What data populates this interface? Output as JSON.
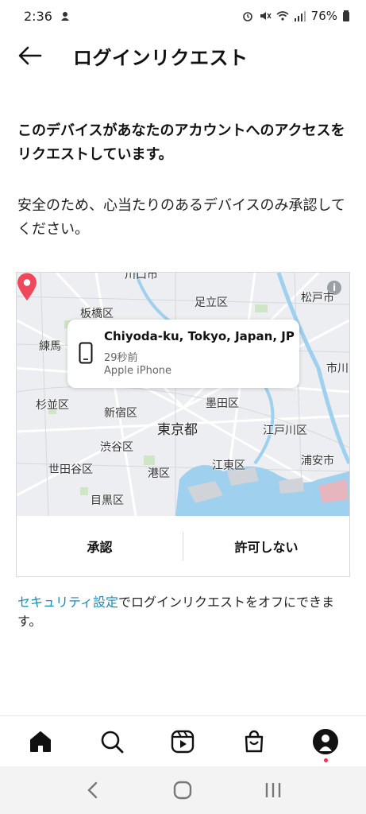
{
  "status_bar": {
    "time": "2:36",
    "battery": "76%"
  },
  "header": {
    "title": "ログインリクエスト"
  },
  "headline": "このデバイスがあなたのアカウントへのアクセスをリクエストしています。",
  "description": "安全のため、心当たりのあるデバイスのみ承認してください。",
  "map": {
    "labels": [
      "川口市",
      "板橋区",
      "足立区",
      "松戸市",
      "練馬",
      "市川",
      "杉並区",
      "新宿区",
      "墨田区",
      "東京都",
      "渋谷区",
      "江戸川区",
      "世田谷区",
      "港区",
      "江東区",
      "浦安市",
      "目黒区"
    ],
    "info_icon": "i"
  },
  "device": {
    "location": "Chiyoda-ku, Tokyo, Japan, JP",
    "time_ago": "29秒前",
    "device_name": "Apple iPhone"
  },
  "actions": {
    "approve": "承認",
    "deny": "許可しない"
  },
  "footer": {
    "link_text": "セキュリティ設定",
    "rest_text": "でログインリクエストをオフにできます。"
  },
  "colors": {
    "accent_link": "#1a8ab3",
    "pin": "#f0475b",
    "water": "#9fd0ee",
    "notification_dot": "#ff2d55"
  },
  "bottom_nav": [
    "home-icon",
    "search-icon",
    "reels-icon",
    "shop-icon",
    "profile-avatar"
  ],
  "system_nav": [
    "back-chevron-icon",
    "home-circle-icon",
    "recents-icon"
  ]
}
